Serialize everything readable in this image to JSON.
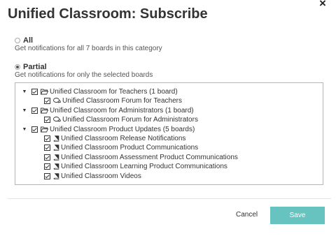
{
  "dialog": {
    "title": "Unified Classroom: Subscribe",
    "close_symbol": "×"
  },
  "options": {
    "all": {
      "label": "All",
      "description": "Get notifications for all 7 boards in this category",
      "selected": false
    },
    "partial": {
      "label": "Partial",
      "description": "Get notifications for only the selected boards",
      "selected": true
    }
  },
  "tree": {
    "groups": [
      {
        "label": "Unified Classroom for Teachers (1 board)",
        "icon": "folder-open-icon",
        "expanded": true,
        "checked": true,
        "boards": [
          {
            "label": "Unified Classroom Forum for Teachers",
            "icon": "forum-icon",
            "checked": true
          }
        ]
      },
      {
        "label": "Unified Classroom for Administrators (1 board)",
        "icon": "folder-open-icon",
        "expanded": true,
        "checked": true,
        "boards": [
          {
            "label": "Unified Classroom Forum for Administrators",
            "icon": "forum-icon",
            "checked": true
          }
        ]
      },
      {
        "label": "Unified Classroom Product Updates (5 boards)",
        "icon": "folder-open-icon",
        "expanded": true,
        "checked": true,
        "boards": [
          {
            "label": "Unified Classroom Release Notifications",
            "icon": "book-icon",
            "checked": true
          },
          {
            "label": "Unified Classroom Product Communications",
            "icon": "book-icon",
            "checked": true
          },
          {
            "label": "Unified Classroom Assessment Product Communications",
            "icon": "book-icon",
            "checked": true
          },
          {
            "label": "Unified Classroom Learning Product Communications",
            "icon": "book-icon",
            "checked": true
          },
          {
            "label": "Unified Classroom Videos",
            "icon": "book-icon",
            "checked": true
          }
        ]
      }
    ]
  },
  "footer": {
    "cancel_label": "Cancel",
    "save_label": "Save"
  },
  "colors": {
    "save_button": "#66c3bf",
    "text": "#333333"
  }
}
